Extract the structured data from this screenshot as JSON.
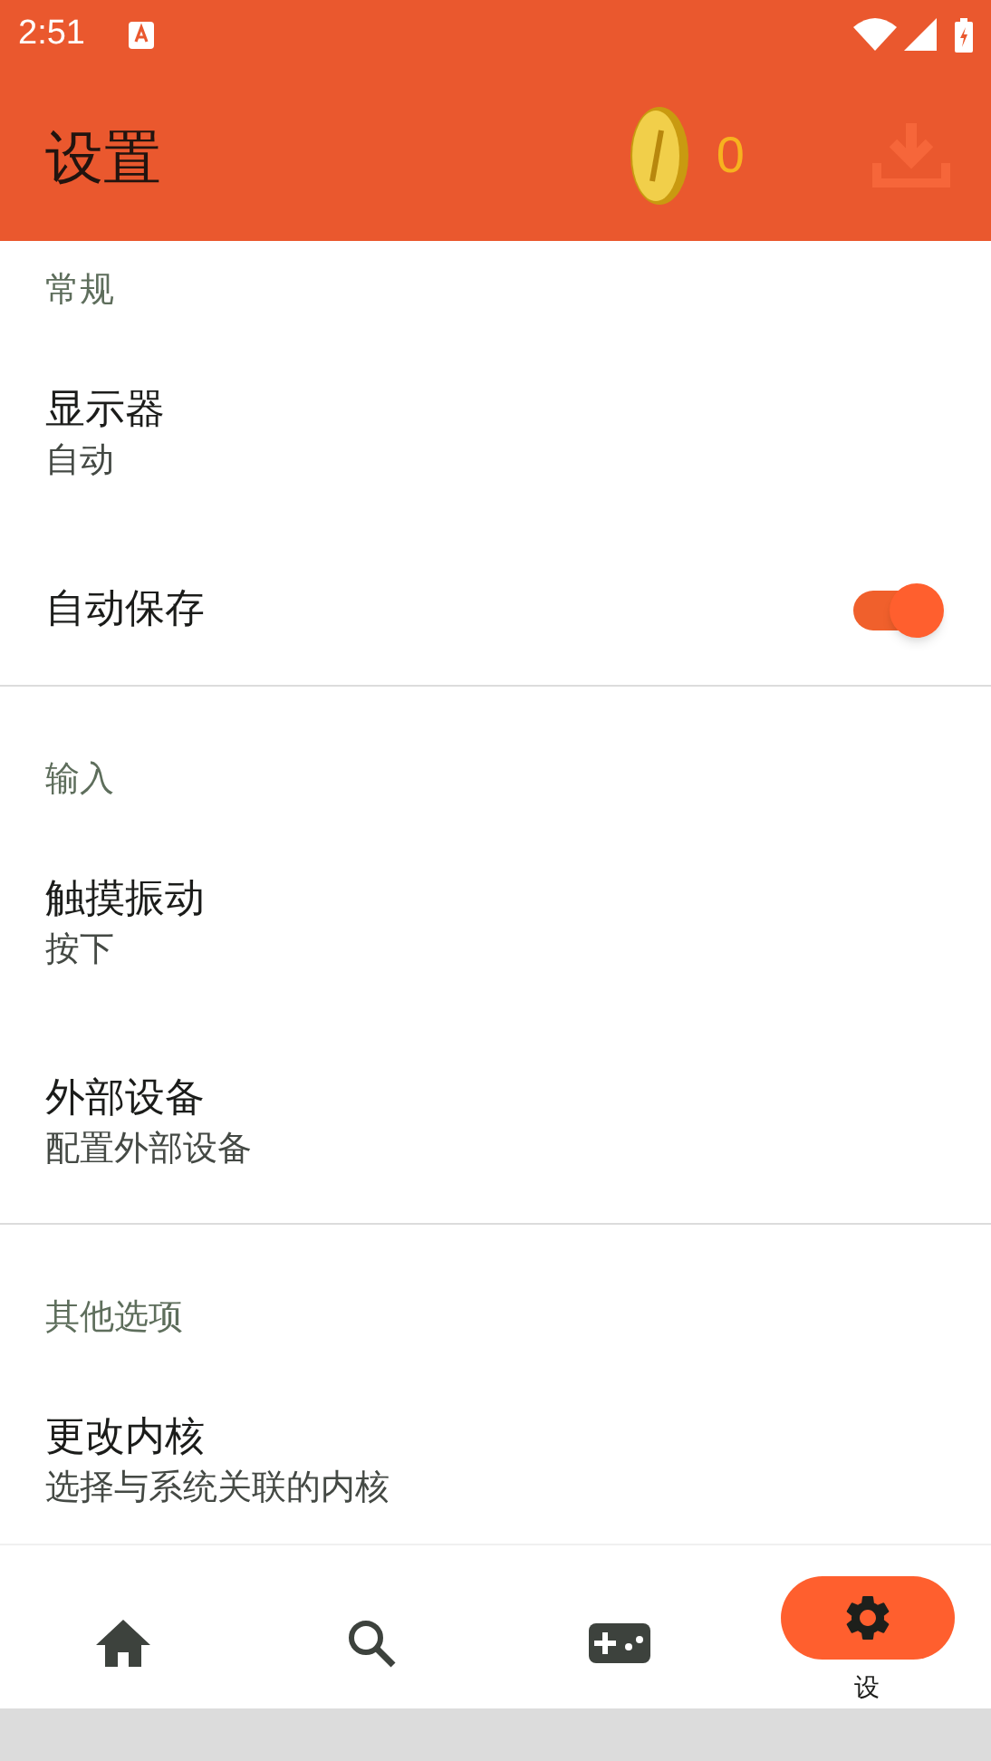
{
  "status_bar": {
    "time": "2:51"
  },
  "app_bar": {
    "title": "设置",
    "coins": "0"
  },
  "sections": [
    {
      "items": [
        {
          "kind": "category",
          "title": "常规"
        },
        {
          "kind": "preference",
          "title": "显示器",
          "summary": "自动"
        },
        {
          "kind": "switch",
          "title": "自动保存",
          "on": true
        }
      ]
    },
    {
      "items": [
        {
          "kind": "category",
          "title": "输入"
        },
        {
          "kind": "preference",
          "title": "触摸振动",
          "summary": "按下"
        },
        {
          "kind": "preference",
          "title": "外部设备",
          "summary": "配置外部设备"
        }
      ]
    },
    {
      "items": [
        {
          "kind": "category",
          "title": "其他选项"
        },
        {
          "kind": "preference",
          "title": "更改内核",
          "summary": "选择与系统关联的内核"
        }
      ]
    }
  ],
  "bottom_nav": [
    {
      "kind": "home",
      "selected": false
    },
    {
      "kind": "search",
      "selected": false
    },
    {
      "kind": "gamepad",
      "selected": false
    },
    {
      "kind": "settings",
      "selected": true,
      "label": "设"
    }
  ]
}
